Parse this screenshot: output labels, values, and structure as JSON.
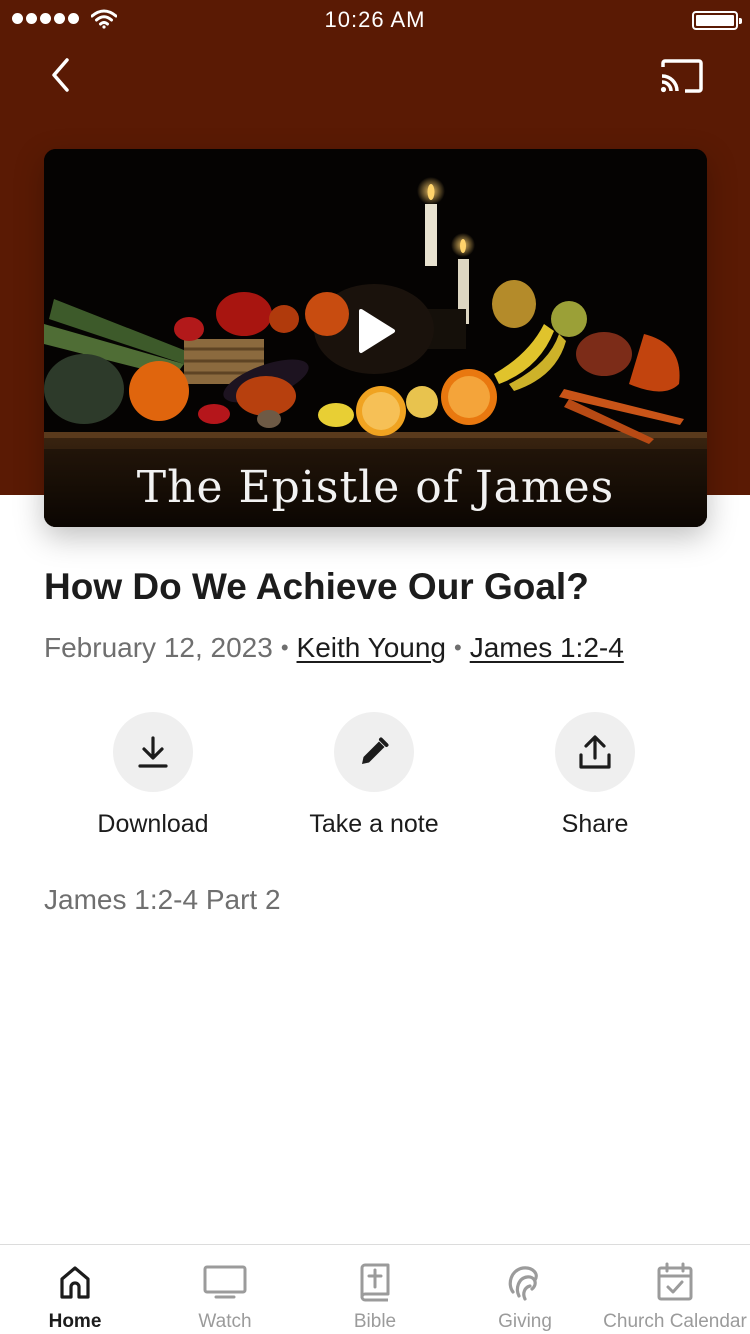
{
  "status_bar": {
    "time": "10:26 AM"
  },
  "header": {
    "back_icon": "chevron-left-icon",
    "cast_icon": "cast-icon"
  },
  "video": {
    "series_title": "The Epistle of James",
    "play_icon": "play-icon"
  },
  "sermon": {
    "title": "How Do We Achieve Our Goal?",
    "date": "February 12, 2023",
    "separator": "•",
    "speaker": "Keith Young",
    "scripture": "James 1:2-4",
    "description": "James 1:2-4 Part 2"
  },
  "actions": [
    {
      "label": "Download",
      "icon": "download-icon"
    },
    {
      "label": "Take a note",
      "icon": "pencil-icon"
    },
    {
      "label": "Share",
      "icon": "share-icon"
    }
  ],
  "tabs": [
    {
      "label": "Home",
      "icon": "home-icon",
      "active": true
    },
    {
      "label": "Watch",
      "icon": "tv-icon",
      "active": false
    },
    {
      "label": "Bible",
      "icon": "bible-icon",
      "active": false
    },
    {
      "label": "Giving",
      "icon": "giving-icon",
      "active": false
    },
    {
      "label": "Church Calendar",
      "icon": "calendar-icon",
      "active": false
    }
  ],
  "colors": {
    "hero_background": "#5a1a04",
    "text_primary": "#1c1c1c",
    "text_secondary": "#6f6f6f",
    "tab_inactive": "#9b9b9b"
  }
}
